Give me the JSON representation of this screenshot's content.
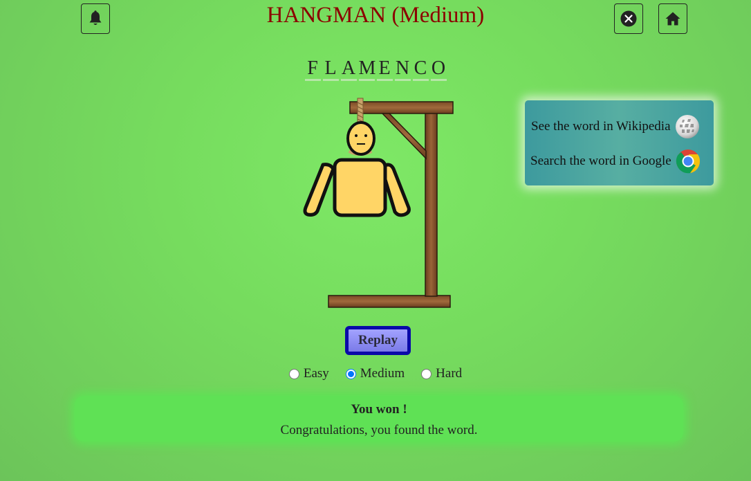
{
  "header": {
    "title": "HANGMAN (Medium)",
    "bell_icon": "bell-icon",
    "close_icon": "close-circle-icon",
    "home_icon": "home-icon",
    "title_color": "#8b0000"
  },
  "word": {
    "letters": [
      "F",
      "L",
      "A",
      "M",
      "E",
      "N",
      "C",
      "O"
    ]
  },
  "hangman": {
    "parts_shown": [
      "head",
      "body",
      "left-arm",
      "right-arm"
    ]
  },
  "links": {
    "wikipedia_label": "See the word in Wikipedia",
    "wikipedia_icon": "wikipedia-icon",
    "google_label": "Search the word in Google",
    "google_icon": "chrome-icon"
  },
  "controls": {
    "replay_label": "Replay",
    "levels": [
      {
        "label": "Easy",
        "selected": false
      },
      {
        "label": "Medium",
        "selected": true
      },
      {
        "label": "Hard",
        "selected": false
      }
    ]
  },
  "result": {
    "title": "You won !",
    "message": "Congratulations, you found the word."
  }
}
